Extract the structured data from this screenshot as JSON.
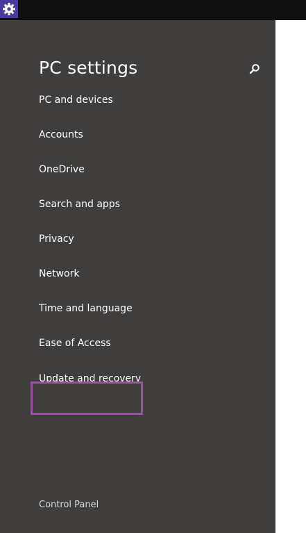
{
  "app": {
    "icon": "gear-icon",
    "accent_color": "#4b3a9e"
  },
  "header": {
    "title": "PC settings",
    "search_icon": "search-icon"
  },
  "sidebar": {
    "background": "#3f3e3c",
    "items": [
      {
        "label": "PC and devices"
      },
      {
        "label": "Accounts"
      },
      {
        "label": "OneDrive"
      },
      {
        "label": "Search and apps"
      },
      {
        "label": "Privacy"
      },
      {
        "label": "Network"
      },
      {
        "label": "Time and language"
      },
      {
        "label": "Ease of Access"
      },
      {
        "label": "Update and recovery",
        "highlighted": true
      }
    ],
    "highlight_color": "#9b4fa5",
    "footer_link": "Control Panel"
  }
}
